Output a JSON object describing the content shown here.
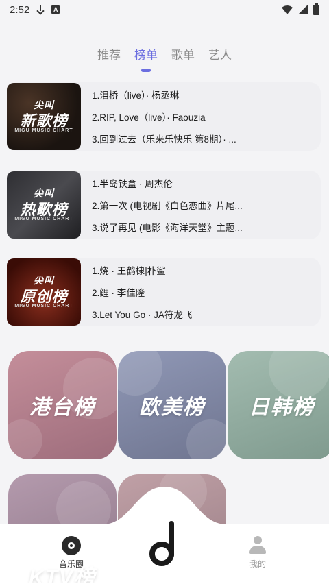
{
  "status_bar": {
    "time": "2:52",
    "a_badge": "A"
  },
  "tabs": [
    {
      "label": "推荐"
    },
    {
      "label": "榜单"
    },
    {
      "label": "歌单"
    },
    {
      "label": "艺人"
    }
  ],
  "active_tab": "榜单",
  "rankings": [
    {
      "cover_small": "尖叫",
      "cover_big": "新歌榜",
      "cover_sub": "MIGU MUSIC CHART",
      "songs": [
        "1.泪桥（live）· 杨丞琳",
        "2.RIP, Love（live）· Faouzia",
        "3.回到过去（乐来乐快乐 第8期）· ..."
      ]
    },
    {
      "cover_small": "尖叫",
      "cover_big": "热歌榜",
      "cover_sub": "MIGU MUSIC CHART",
      "songs": [
        "1.半岛铁盒 · 周杰伦",
        "2.第一次 (电视剧《白色恋曲》片尾...",
        "3.说了再见 (电影《海洋天堂》主题..."
      ]
    },
    {
      "cover_small": "尖叫",
      "cover_big": "原创榜",
      "cover_sub": "MIGU MUSIC CHART",
      "songs": [
        "1.烧 · 王鹤棣|朴鲨",
        "2.鲤 · 李佳隆",
        "3.Let You Go · JA符龙飞"
      ]
    }
  ],
  "region_tiles": [
    "港台榜",
    "欧美榜",
    "日韩榜",
    "KTV榜",
    ""
  ],
  "bottom_nav": {
    "left_label": "音乐圈",
    "right_label": "我的"
  },
  "colors": {
    "accent": "#6b6ee0"
  }
}
